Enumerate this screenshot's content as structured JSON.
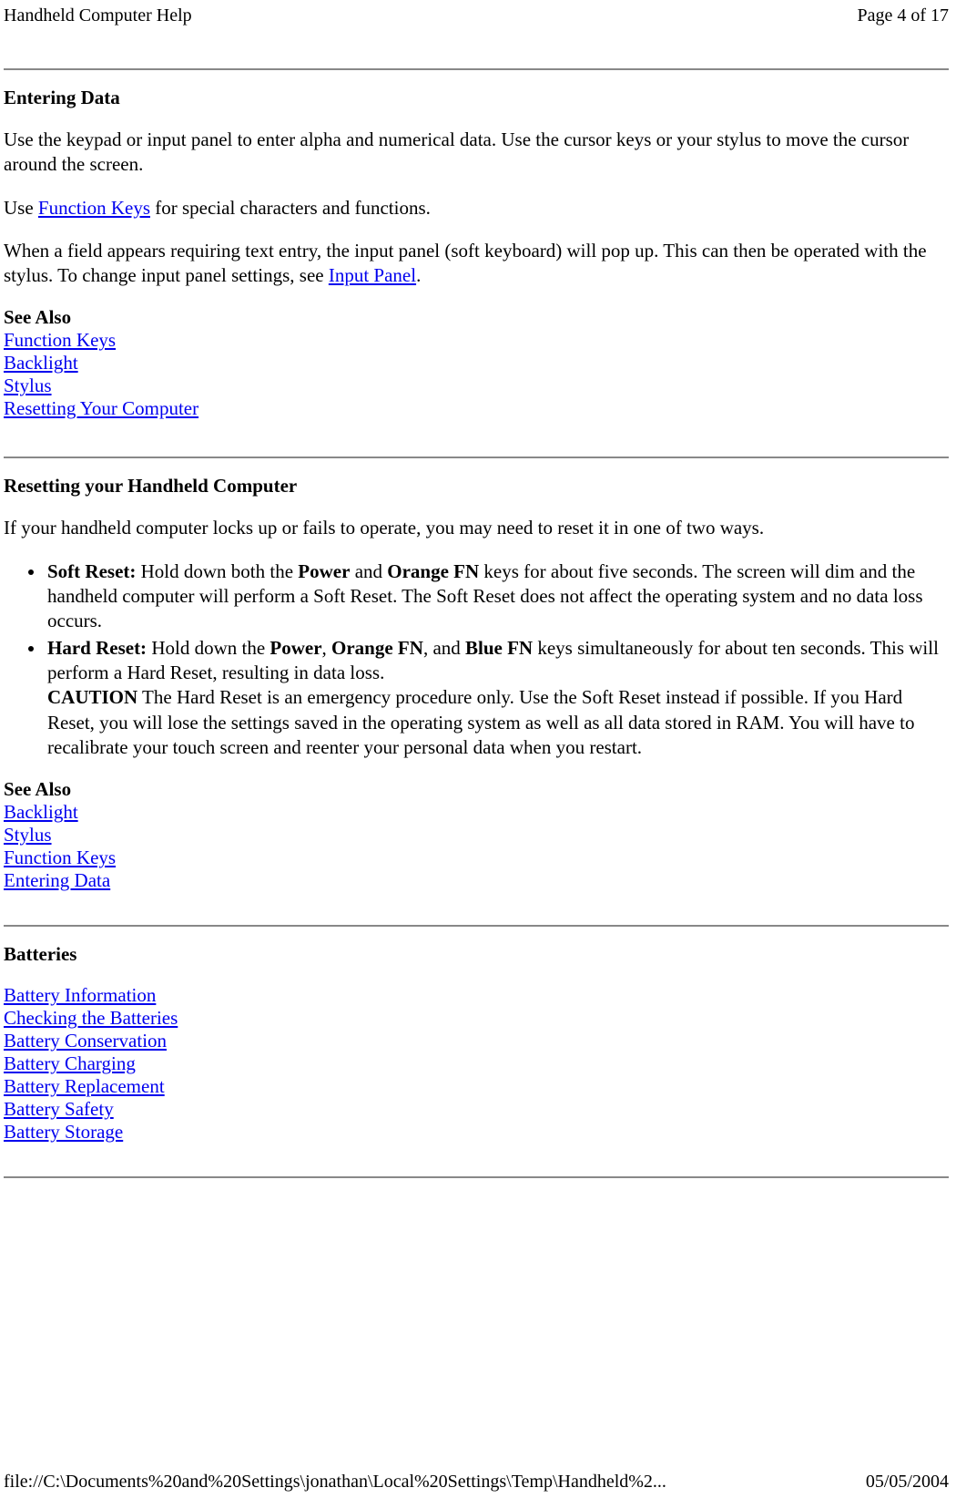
{
  "header": {
    "title": "Handheld Computer Help",
    "page": "Page 4 of 17"
  },
  "sec1": {
    "title": "Entering Data",
    "p1": "Use the keypad or input panel to enter alpha and numerical data. Use the cursor keys or your stylus to move the cursor around the screen.",
    "p2a": "Use ",
    "p2link": "Function Keys",
    "p2b": " for special characters and functions.",
    "p3a": "When a field appears requiring text entry, the input panel (soft keyboard) will pop up. This can then be operated with the stylus. To change input panel settings, see ",
    "p3link": "Input Panel",
    "p3b": ".",
    "see_also": "See Also",
    "links": {
      "l1": "Function Keys",
      "l2": "Backlight",
      "l3": "Stylus",
      "l4": "Resetting Your Computer"
    }
  },
  "sec2": {
    "title": "Resetting your Handheld Computer",
    "p1": "If your handheld computer locks up or fails to operate, you may need to reset it in one of two ways.",
    "li1": {
      "a": "Soft Reset:",
      "b": "  Hold down both the ",
      "c": "Power",
      "d": " and ",
      "e": "Orange FN",
      "f": " keys for about five seconds. The screen will dim and the handheld computer will perform a Soft Reset. The Soft Reset does not affect the operating system and no data loss occurs."
    },
    "li2": {
      "a": "Hard Reset:",
      "b": "  Hold down the ",
      "c": "Power",
      "d": ", ",
      "e": "Orange FN",
      "f": ", and ",
      "g": "Blue FN",
      "h": " keys simultaneously for about ten seconds. This will perform a Hard Reset, resulting in data loss.",
      "i": "CAUTION",
      "j": " The Hard Reset is an emergency procedure only. Use the Soft Reset instead if possible. If you Hard Reset, you will lose the settings saved in the operating system as well as all data stored in RAM. You will have to recalibrate your touch screen and reenter your personal data when you restart."
    },
    "see_also": "See Also",
    "links": {
      "l1": "Backlight",
      "l2": "Stylus",
      "l3": "Function Keys",
      "l4": "Entering Data"
    }
  },
  "sec3": {
    "title": "Batteries",
    "links": {
      "l1": "Battery Information",
      "l2": "Checking the Batteries",
      "l3": "Battery Conservation",
      "l4": "Battery Charging",
      "l5": "Battery Replacement",
      "l6": "Battery Safety",
      "l7": "Battery Storage"
    }
  },
  "footer": {
    "path": "file://C:\\Documents%20and%20Settings\\jonathan\\Local%20Settings\\Temp\\Handheld%2...",
    "date": "05/05/2004"
  }
}
